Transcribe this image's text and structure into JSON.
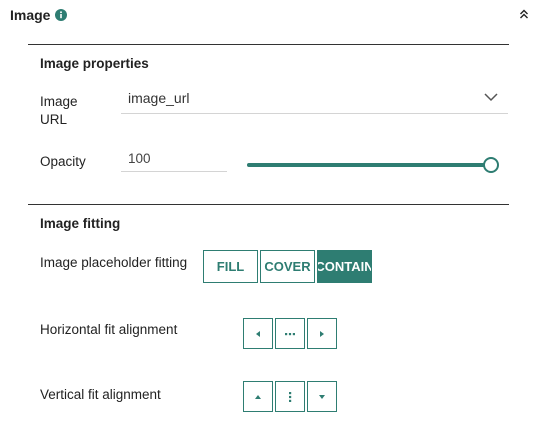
{
  "header": {
    "title": "Image",
    "info_icon": "info-circle-icon",
    "collapse_icon": "double-chevron-up-icon"
  },
  "image_properties": {
    "title": "Image properties",
    "url_label": "Image URL",
    "url_value": "image_url",
    "opacity_label": "Opacity",
    "opacity_value": "100",
    "opacity_slider_fraction": 1.0
  },
  "image_fitting": {
    "title": "Image fitting",
    "placeholder_label": "Image placeholder fitting",
    "fit_options": [
      "FILL",
      "COVER",
      "CONTAIN"
    ],
    "selected_fit": "CONTAIN",
    "horizontal_label": "Horizontal fit alignment",
    "horizontal_icons": [
      "caret-left-icon",
      "ellipsis-horizontal-icon",
      "caret-right-icon"
    ],
    "vertical_label": "Vertical fit alignment",
    "vertical_icons": [
      "caret-up-icon",
      "ellipsis-vertical-icon",
      "caret-down-icon"
    ]
  },
  "colors": {
    "accent": "#2e7d72",
    "divider": "#333333",
    "input_underline": "#d4d4d4"
  }
}
